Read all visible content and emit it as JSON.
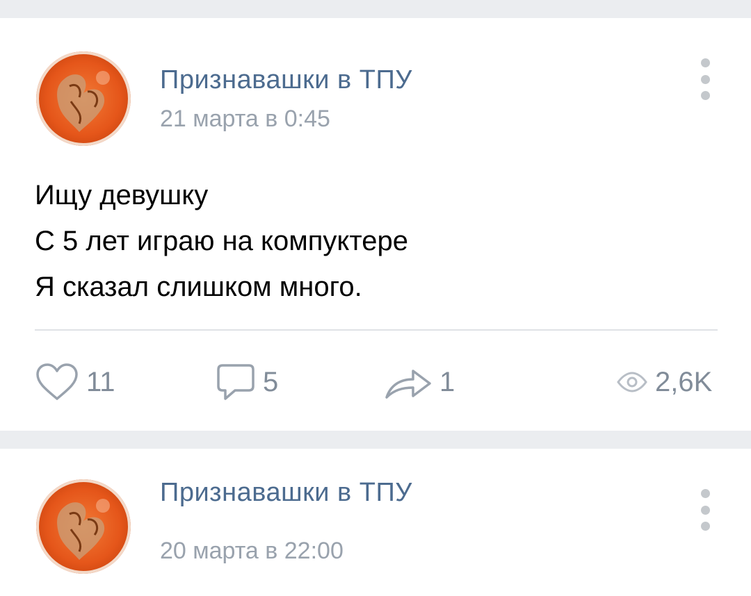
{
  "posts": [
    {
      "author": "Признавашки в ТПУ",
      "date": "21 марта в 0:45",
      "text_lines": [
        "Ищу девушку",
        "С 5 лет играю на компуктере",
        "Я сказал слишком много."
      ],
      "likes": "11",
      "comments": "5",
      "shares": "1",
      "views": "2,6K"
    },
    {
      "author": "Признавашки в ТПУ",
      "date": "20 марта в 22:00"
    }
  ],
  "icons": {
    "like": "heart-icon",
    "comment": "comment-icon",
    "share": "share-icon",
    "views": "eye-icon",
    "menu": "more-vertical-icon"
  },
  "colors": {
    "author": "#4c6b8f",
    "meta": "#99a2ad",
    "action": "#818c99",
    "background": "#ebedf0"
  }
}
